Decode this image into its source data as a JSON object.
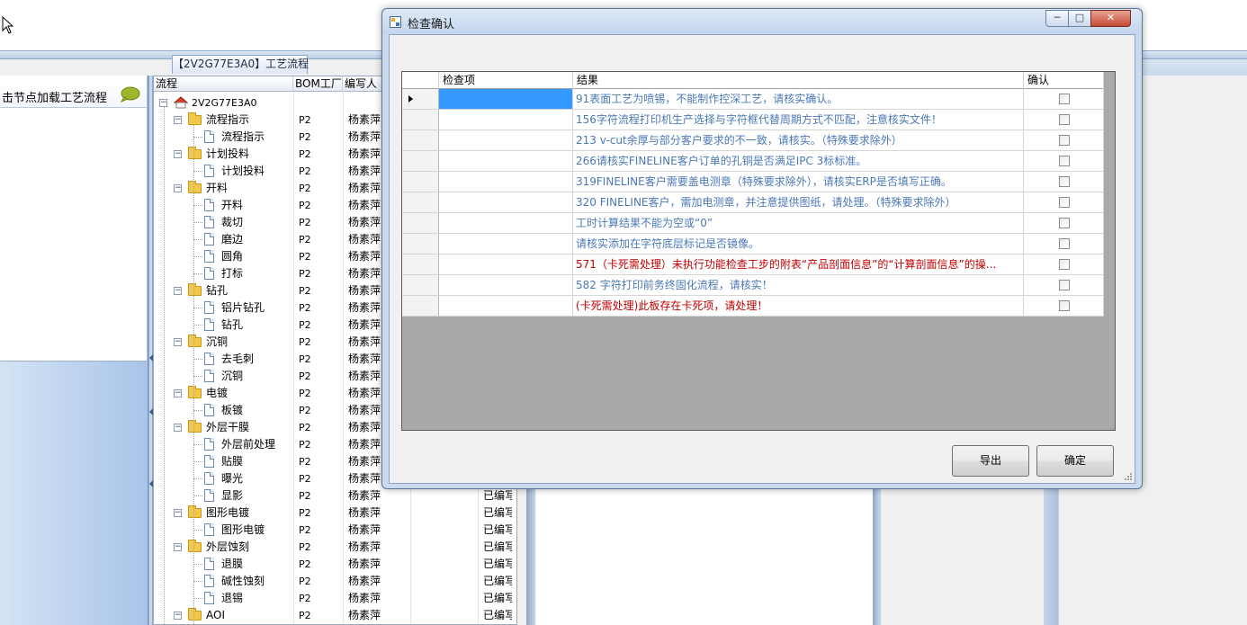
{
  "left_panel": {
    "hint": "击节点加载工艺流程"
  },
  "tree_tab": {
    "label": "【2V2G77E3A0】工艺流程"
  },
  "tree_grid": {
    "headers": [
      "流程",
      "BOM工厂",
      "编写人"
    ],
    "root": "2V2G77E3A0",
    "rows": [
      {
        "label": "流程指示",
        "type": "folder",
        "factory": "P2",
        "author": "杨素萍",
        "status": ""
      },
      {
        "label": "流程指示",
        "type": "doc",
        "factory": "P2",
        "author": "杨素萍",
        "status": ""
      },
      {
        "label": "计划投料",
        "type": "folder",
        "factory": "P2",
        "author": "杨素萍",
        "status": ""
      },
      {
        "label": "计划投料",
        "type": "doc",
        "factory": "P2",
        "author": "杨素萍",
        "status": ""
      },
      {
        "label": "开料",
        "type": "folder",
        "factory": "P2",
        "author": "杨素萍",
        "status": ""
      },
      {
        "label": "开料",
        "type": "doc",
        "factory": "P2",
        "author": "杨素萍",
        "status": ""
      },
      {
        "label": "裁切",
        "type": "doc",
        "factory": "P2",
        "author": "杨素萍",
        "status": ""
      },
      {
        "label": "磨边",
        "type": "doc",
        "factory": "P2",
        "author": "杨素萍",
        "status": ""
      },
      {
        "label": "圆角",
        "type": "doc",
        "factory": "P2",
        "author": "杨素萍",
        "status": ""
      },
      {
        "label": "打标",
        "type": "doc",
        "factory": "P2",
        "author": "杨素萍",
        "status": ""
      },
      {
        "label": "钻孔",
        "type": "folder",
        "factory": "P2",
        "author": "杨素萍",
        "status": ""
      },
      {
        "label": "铝片钻孔",
        "type": "doc",
        "factory": "P2",
        "author": "杨素萍",
        "status": ""
      },
      {
        "label": "钻孔",
        "type": "doc",
        "factory": "P2",
        "author": "杨素萍",
        "status": ""
      },
      {
        "label": "沉铜",
        "type": "folder",
        "factory": "P2",
        "author": "杨素萍",
        "status": ""
      },
      {
        "label": "去毛刺",
        "type": "doc",
        "factory": "P2",
        "author": "杨素萍",
        "status": ""
      },
      {
        "label": "沉铜",
        "type": "doc",
        "factory": "P2",
        "author": "杨素萍",
        "status": ""
      },
      {
        "label": "电镀",
        "type": "folder",
        "factory": "P2",
        "author": "杨素萍",
        "status": ""
      },
      {
        "label": "板镀",
        "type": "doc",
        "factory": "P2",
        "author": "杨素萍",
        "status": ""
      },
      {
        "label": "外层干膜",
        "type": "folder",
        "factory": "P2",
        "author": "杨素萍",
        "status": ""
      },
      {
        "label": "外层前处理",
        "type": "doc",
        "factory": "P2",
        "author": "杨素萍",
        "status": ""
      },
      {
        "label": "贴膜",
        "type": "doc",
        "factory": "P2",
        "author": "杨素萍",
        "status": ""
      },
      {
        "label": "曝光",
        "type": "doc",
        "factory": "P2",
        "author": "杨素萍",
        "status": ""
      },
      {
        "label": "显影",
        "type": "doc",
        "factory": "P2",
        "author": "杨素萍",
        "status": "已编写"
      },
      {
        "label": "图形电镀",
        "type": "folder",
        "factory": "P2",
        "author": "杨素萍",
        "status": "已编写"
      },
      {
        "label": "图形电镀",
        "type": "doc",
        "factory": "P2",
        "author": "杨素萍",
        "status": "已编写"
      },
      {
        "label": "外层蚀刻",
        "type": "folder",
        "factory": "P2",
        "author": "杨素萍",
        "status": "已编写"
      },
      {
        "label": "退膜",
        "type": "doc",
        "factory": "P2",
        "author": "杨素萍",
        "status": "已编写"
      },
      {
        "label": "碱性蚀刻",
        "type": "doc",
        "factory": "P2",
        "author": "杨素萍",
        "status": "已编写"
      },
      {
        "label": "退锡",
        "type": "doc",
        "factory": "P2",
        "author": "杨素萍",
        "status": "已编写"
      },
      {
        "label": "AOI",
        "type": "folder",
        "factory": "P2",
        "author": "杨素萍",
        "status": "已编写"
      }
    ]
  },
  "dialog": {
    "title": "检查确认",
    "window_buttons": {
      "minimize": "─",
      "maximize": "□",
      "close": "✕"
    },
    "columns": [
      "检查项",
      "结果",
      "确认"
    ],
    "rows": [
      {
        "result": "91表面工艺为喷锡，不能制作控深工艺，请核实确认。",
        "color": "#4a78b5",
        "checked": false
      },
      {
        "result": "156字符流程打印机生产选择与字符框代替周期方式不匹配，注意核实文件！",
        "color": "#4a78b5",
        "checked": false
      },
      {
        "result": "213 v-cut余厚与部分客户要求的不一致，请核实。（特殊要求除外）",
        "color": "#4a78b5",
        "checked": false
      },
      {
        "result": "266请核实FINELINE客户订单的孔铜是否满足IPC 3标标准。",
        "color": "#4a78b5",
        "checked": false
      },
      {
        "result": "319FINELINE客户需要盖电测章（特殊要求除外），请核实ERP是否填写正确。",
        "color": "#4a78b5",
        "checked": false
      },
      {
        "result": "320 FINELINE客户，需加电测章，并注意提供图纸，请处理。（特殊要求除外）",
        "color": "#4a78b5",
        "checked": false
      },
      {
        "result": "工时计算结果不能为空或“0”",
        "color": "#4a78b5",
        "checked": false
      },
      {
        "result": "请核实添加在字符底层标记是否镜像。",
        "color": "#4a78b5",
        "checked": false
      },
      {
        "result": "571（卡死需处理）未执行功能检查工步的附表“产品剖面信息”的“计算剖面信息”的操...",
        "color": "#c00000",
        "checked": false
      },
      {
        "result": "582 字符打印前务终固化流程，请核实！",
        "color": "#4a78b5",
        "checked": false
      },
      {
        "result": "(卡死需处理)此板存在卡死项，请处理！",
        "color": "#c00000",
        "checked": false
      }
    ],
    "export_label": "导出",
    "ok_label": "确定"
  }
}
